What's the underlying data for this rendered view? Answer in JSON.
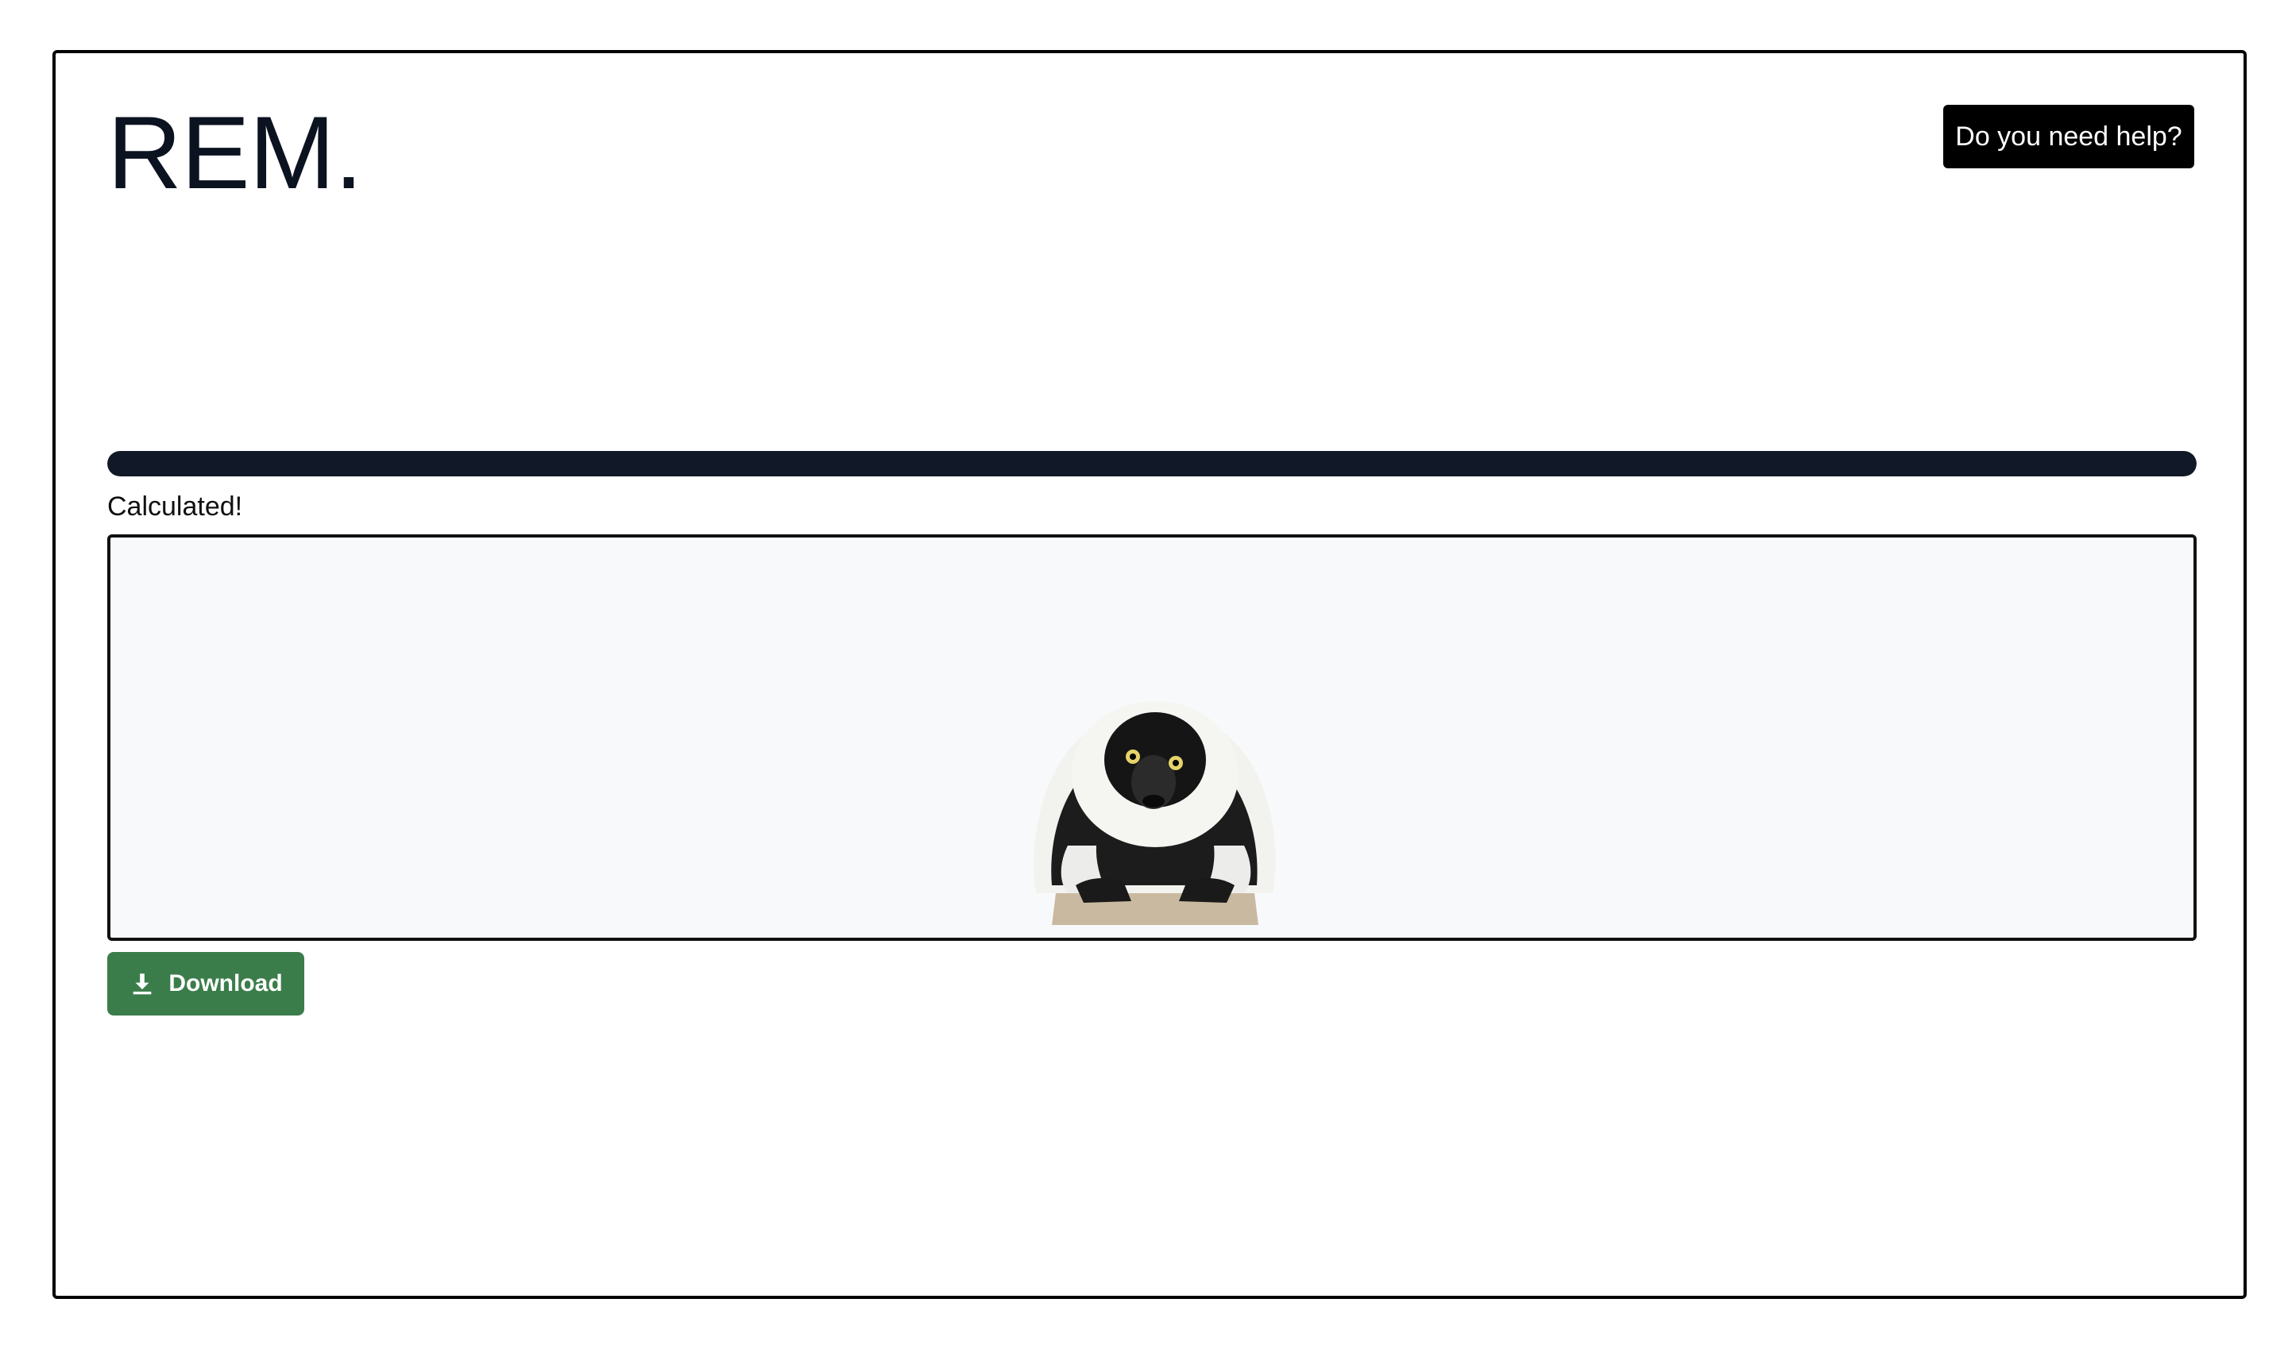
{
  "brand": {
    "logo_text": "REM."
  },
  "header": {
    "help_label": "Do you need help?"
  },
  "progress": {
    "value": 1.0,
    "status": "Calculated!"
  },
  "preview": {
    "image": "lemur-icon"
  },
  "actions": {
    "download_label": "Download",
    "download_icon": "download-icon"
  },
  "colors": {
    "progress_fill": "#111827",
    "help_button_bg": "#000000",
    "download_button_bg": "#3b7d4a",
    "preview_bg": "#f8f9fa"
  }
}
